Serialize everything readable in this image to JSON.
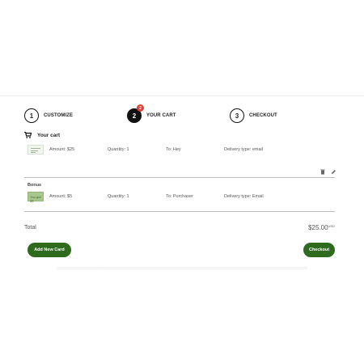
{
  "steps": [
    {
      "number": "1",
      "label": "CUSTOMIZE",
      "active": false
    },
    {
      "number": "2",
      "label": "YOUR CART",
      "active": true,
      "badge": "2"
    },
    {
      "number": "3",
      "label": "CHECKOUT",
      "active": false
    }
  ],
  "cart": {
    "title": "Your cart",
    "items": [
      {
        "amount": "Amount: $25",
        "quantity": "Quantity: 1",
        "to": "To: Hey",
        "delivery": "Delivery type: email"
      }
    ],
    "bonus": {
      "label": "Bonus",
      "thumb_text": "You got $5",
      "amount": "Amount: $5",
      "quantity": "Quantity: 1",
      "to": "To: Purchaser",
      "delivery": "Delivery type: Email"
    }
  },
  "total": {
    "label": "Total",
    "value": "$25.00",
    "cents": "USD"
  },
  "buttons": {
    "add": "Add New Card",
    "checkout": "Checkout"
  },
  "colors": {
    "brand": "#2e6b1e",
    "badge": "#e0403a"
  }
}
